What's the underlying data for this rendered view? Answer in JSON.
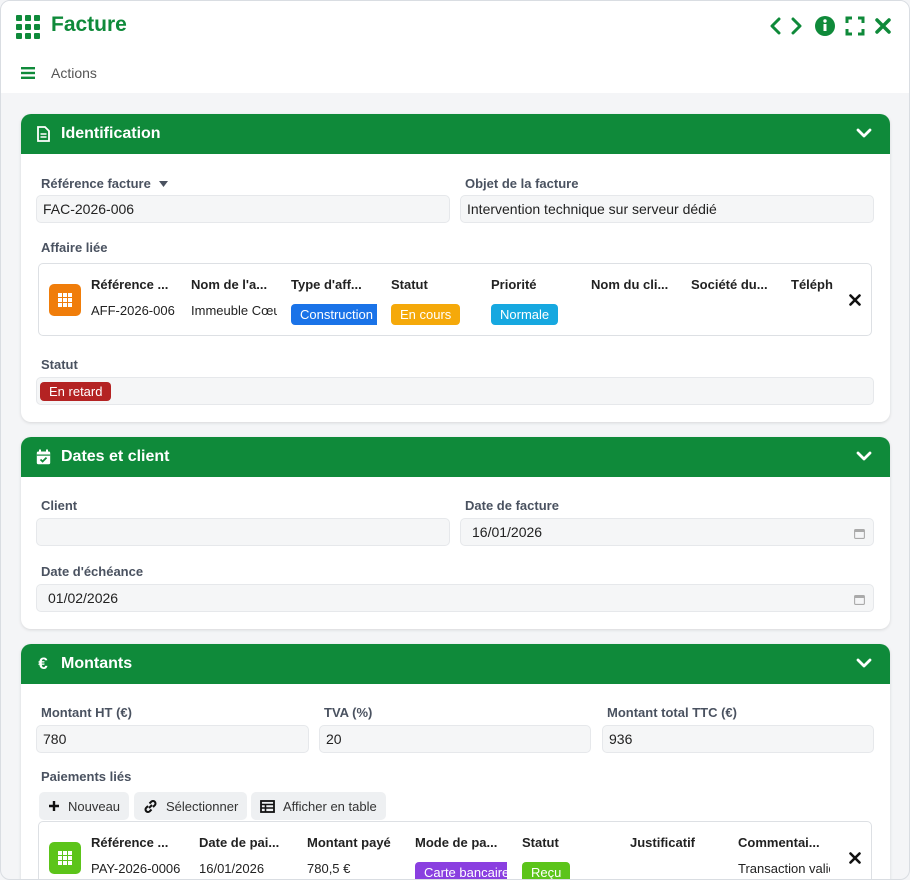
{
  "window": {
    "title": "Facture",
    "actions_label": "Actions"
  },
  "icons": {
    "app": "grid-icon",
    "prev": "chevron-left-icon",
    "next": "chevron-right-icon",
    "info": "info-icon",
    "fullscreen": "expand-icon",
    "close": "close-icon"
  },
  "colors": {
    "brand": "#0f8a3a",
    "blue": "#1a73e8",
    "orange": "#f5a90a",
    "cyan": "#16a8e0",
    "red": "#b42323",
    "purple": "#8a3fe0",
    "lime": "#5cc41a"
  },
  "identification": {
    "title": "Identification",
    "ref_label": "Référence facture",
    "ref_value": "FAC-2026-006",
    "objet_label": "Objet de la facture",
    "objet_value": "Intervention technique sur serveur dédié",
    "affaire_label": "Affaire liée",
    "affaire": {
      "headers": [
        "Référence ...",
        "Nom de l'a...",
        "Type d'aff...",
        "Statut",
        "Priorité",
        "Nom du cli...",
        "Société du...",
        "Téléph"
      ],
      "reference": "AFF-2026-006",
      "nom": "Immeuble Cœur",
      "type": "Construction",
      "statut": "En cours",
      "priorite": "Normale"
    },
    "statut_label": "Statut",
    "statut_value": "En retard"
  },
  "dates": {
    "title": "Dates et client",
    "client_label": "Client",
    "client_value": "",
    "date_facture_label": "Date de facture",
    "date_facture_value": "16/01/2026",
    "echeance_label": "Date d'échéance",
    "echeance_value": "01/02/2026"
  },
  "montants": {
    "title": "Montants",
    "ht_label": "Montant HT (€)",
    "ht_value": "780",
    "tva_label": "TVA (%)",
    "tva_value": "20",
    "ttc_label": "Montant total TTC (€)",
    "ttc_value": "936",
    "paiements_label": "Paiements liés",
    "buttons": {
      "nouveau": "Nouveau",
      "selectionner": "Sélectionner",
      "afficher": "Afficher en table"
    },
    "paiement": {
      "headers": [
        "Référence ...",
        "Date de pai...",
        "Montant payé",
        "Mode de pa...",
        "Statut",
        "Justificatif",
        "Commentai..."
      ],
      "reference": "PAY-2026-0006",
      "date": "16/01/2026",
      "montant": "780,5 €",
      "mode": "Carte bancaire",
      "statut": "Reçu",
      "justificatif": "",
      "commentaire": "Transaction validée"
    }
  }
}
